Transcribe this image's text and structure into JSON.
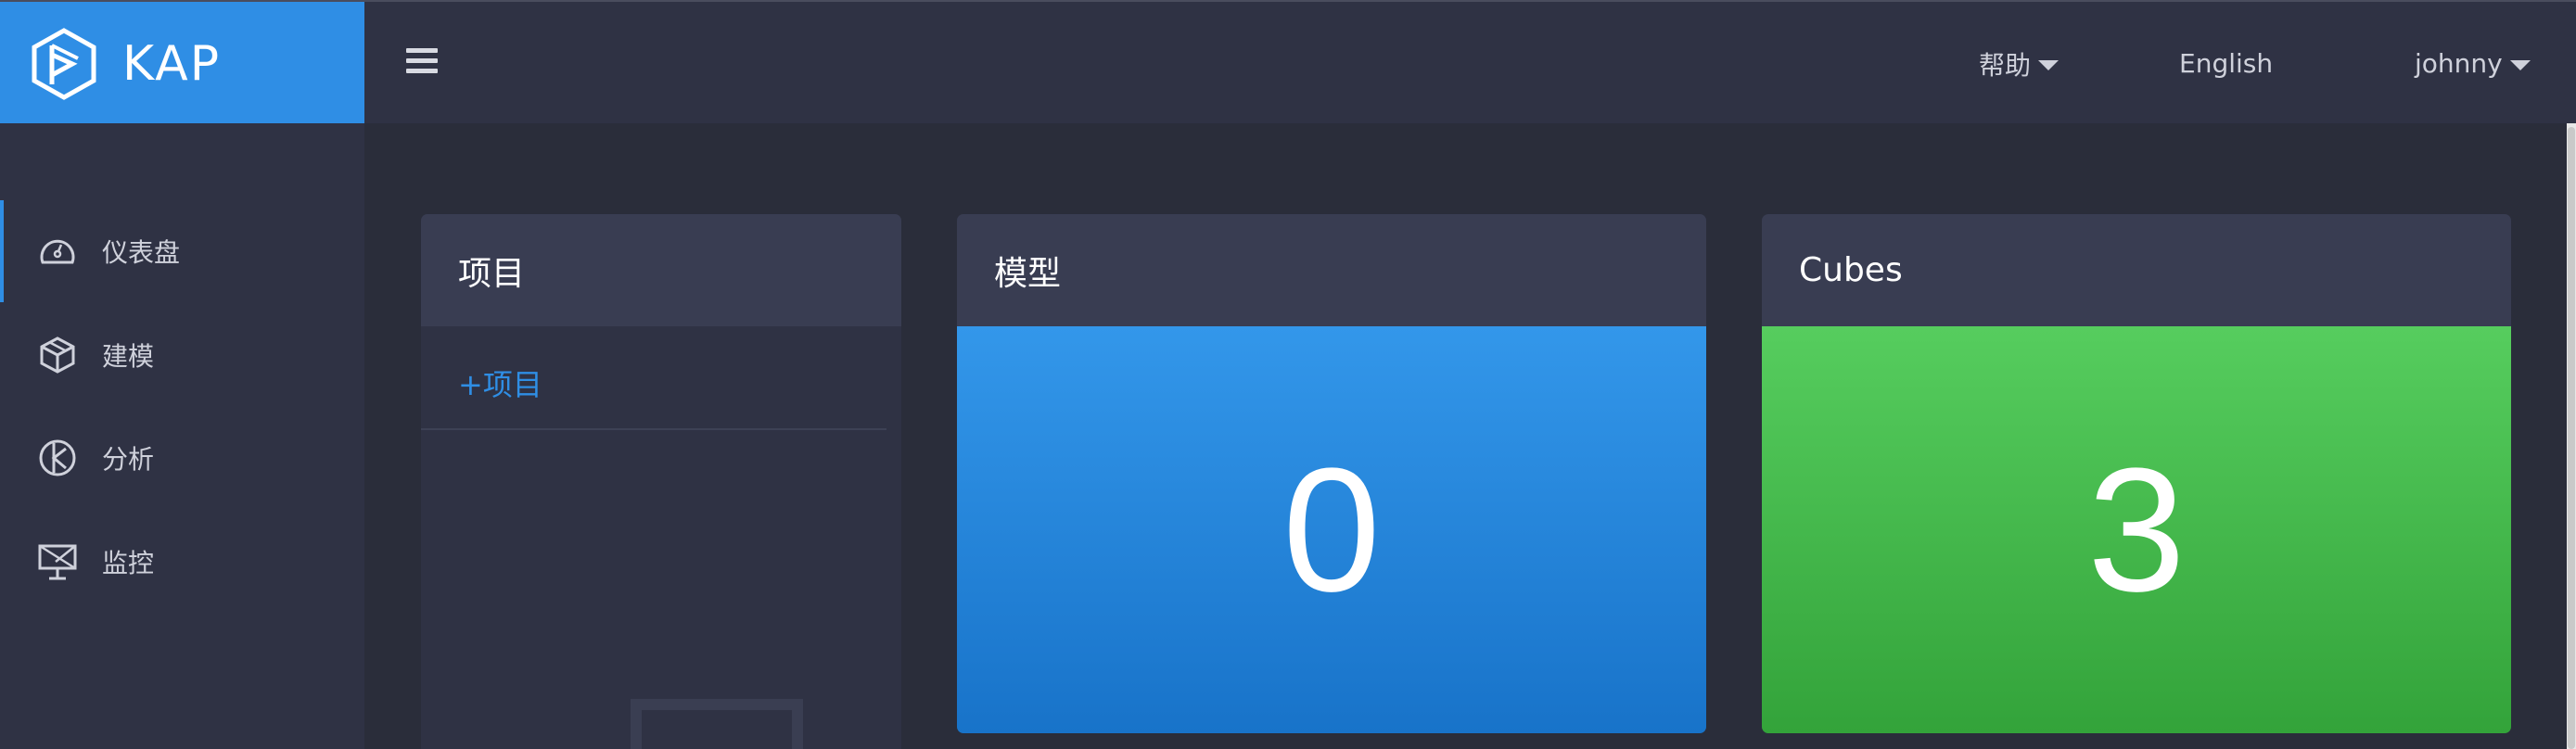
{
  "header": {
    "brand": "KAP",
    "help_label": "帮助",
    "language_label": "English",
    "user_label": "johnny"
  },
  "sidebar": {
    "items": [
      {
        "label": "仪表盘",
        "icon": "dashboard-icon",
        "active": true
      },
      {
        "label": "建模",
        "icon": "cube-icon",
        "active": false
      },
      {
        "label": "分析",
        "icon": "analysis-icon",
        "active": false
      },
      {
        "label": "监控",
        "icon": "monitor-icon",
        "active": false
      }
    ]
  },
  "dashboard": {
    "projects": {
      "title": "项目",
      "add_label": "+项目"
    },
    "models": {
      "title": "模型",
      "count": "0",
      "color": "#2f8ee5"
    },
    "cubes": {
      "title": "Cubes",
      "count": "3",
      "color": "#45b94b"
    }
  },
  "colors": {
    "accent": "#2f8ee5",
    "header_bg": "#2f3244",
    "content_bg": "#2a2d3a"
  }
}
